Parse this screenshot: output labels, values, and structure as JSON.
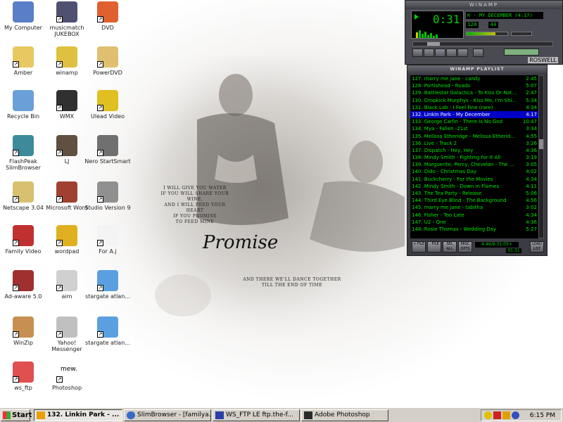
{
  "desktop": {
    "icons": [
      {
        "label": "My Computer",
        "icon": "my-computer-icon"
      },
      {
        "label": "Amber",
        "icon": "folder-icon"
      },
      {
        "label": "Recycle Bin",
        "icon": "recycle-bin-icon"
      },
      {
        "label": "FlashPeak SlimBrowser",
        "icon": "slimbrowser-icon"
      },
      {
        "label": "Netscape 3.04",
        "icon": "netscape-icon"
      },
      {
        "label": "Family Video",
        "icon": "family-video-icon"
      },
      {
        "label": "Ad-aware 5.0",
        "icon": "adaware-icon"
      },
      {
        "label": "WinZip",
        "icon": "winzip-icon"
      },
      {
        "label": "ws_ftp",
        "icon": "ws-ftp-icon"
      },
      {
        "label": "musicmatch JUKEBOX",
        "icon": "musicmatch-icon"
      },
      {
        "label": "winamp",
        "icon": "winamp-icon"
      },
      {
        "label": "WMX",
        "icon": "wmx-icon"
      },
      {
        "label": "LJ",
        "icon": "lj-icon"
      },
      {
        "label": "Microsoft Word",
        "icon": "word-icon"
      },
      {
        "label": "wordpad",
        "icon": "wordpad-icon"
      },
      {
        "label": "aim",
        "icon": "aim-icon"
      },
      {
        "label": "Yahoo! Messenger",
        "icon": "yahoo-messenger-icon"
      },
      {
        "label": "Photoshop",
        "icon": "photoshop-icon"
      },
      {
        "label": "DVD",
        "icon": "dvd-icon"
      },
      {
        "label": "PowerDVD",
        "icon": "powerdvd-icon"
      },
      {
        "label": "Ulead Video",
        "icon": "ulead-video-icon"
      },
      {
        "label": "Nero StartSmart",
        "icon": "nero-icon"
      },
      {
        "label": "Studio Version 9",
        "icon": "studio-icon"
      },
      {
        "label": "For A.j",
        "icon": "document-icon"
      },
      {
        "label": "stargate atlan...",
        "icon": "stargate-icon"
      },
      {
        "label": "stargate atlan...",
        "icon": "stargate-icon"
      }
    ],
    "photoshop_badge": "mew.",
    "wallpaper": {
      "title": "Promise",
      "verse1": [
        "I WILL GIVE YOU WATER",
        "IF YOU WILL SHARE YOUR WINE,",
        "AND I WILL FEED YOUR HEART",
        "IF YOU PROMISE",
        "TO FEED MINE"
      ],
      "verse2": [
        "AND THERE WE'LL DANCE TOGETHER",
        "TILL THE END OF TIME"
      ]
    }
  },
  "winamp": {
    "title": "WINAMP",
    "time": "0:31",
    "song": "K - MY DECEMBER (4:17)",
    "kbps": "128",
    "khz": "44",
    "skin_label": "ROSWELL",
    "accent": "#00d000"
  },
  "playlist": {
    "title": "WINAMP PLAYLIST",
    "items": [
      {
        "title": "127. marry me jane - candy",
        "dur": "2:45"
      },
      {
        "title": "128. Portishead - Roads",
        "dur": "5:07"
      },
      {
        "title": "129. Battlestar Galactica - To Kiss Or Not T...",
        "dur": "2:47"
      },
      {
        "title": "130. Dropkick Murphys - Kiss Me, I'm Shittac...",
        "dur": "5:34"
      },
      {
        "title": "131. Black Lab - I Feel Fine (rare)",
        "dur": "4:34"
      },
      {
        "title": "132. Linkin Park - My December",
        "dur": "4:17"
      },
      {
        "title": "133. George Carlin - There Is No God",
        "dur": "10:47"
      },
      {
        "title": "134. Mya - Fallen -21st",
        "dur": "3:34"
      },
      {
        "title": "135. Melissa Etheridge - Melissa Etheridge ...",
        "dur": "4:55"
      },
      {
        "title": "136. Live - Track 2",
        "dur": "3:26"
      },
      {
        "title": "137. Dispatch - Hey, Hey",
        "dur": "4:36"
      },
      {
        "title": "138. Mindy Smith - Fighting for It All",
        "dur": "3:19"
      },
      {
        "title": "139. Marguerite, Percy, Chevelan - The Ri...",
        "dur": "3:05"
      },
      {
        "title": "140. Dido - Christmas Day",
        "dur": "4:02"
      },
      {
        "title": "141. Buckcherry - For the Movies",
        "dur": "4:34"
      },
      {
        "title": "142. Mindy Smith - Down in Flames",
        "dur": "4:11"
      },
      {
        "title": "143. The Tea Party - Release",
        "dur": "5:06"
      },
      {
        "title": "144. Third Eye Blind - The Background",
        "dur": "4:56"
      },
      {
        "title": "145. marry me jane - tabitha",
        "dur": "3:02"
      },
      {
        "title": "146. Fisher - Too Late",
        "dur": "4:34"
      },
      {
        "title": "147. U2 - One",
        "dur": "4:36"
      },
      {
        "title": "148. Rosie Thomas - Wedding Day",
        "dur": "5:27"
      }
    ],
    "active_index": 5,
    "buttons": [
      "+ FILE",
      "- FILE",
      "SEL ALL",
      "MISC OPTS"
    ],
    "list_button": "LOAD LIST",
    "total_time": "4:46/9:31:05+",
    "current_time": "01:31"
  },
  "taskbar": {
    "start_label": "Start",
    "tasks": [
      {
        "label": "132. Linkin Park - ...",
        "active": true,
        "icon": "winamp-icon"
      },
      {
        "label": "SlimBrowser - [familya...",
        "active": false,
        "icon": "slimbrowser-icon"
      },
      {
        "label": "WS_FTP LE ftp.the-f...",
        "active": false,
        "icon": "ws-ftp-icon"
      },
      {
        "label": "Adobe Photoshop",
        "active": false,
        "icon": "photoshop-icon"
      }
    ],
    "clock": "6:15 PM"
  }
}
